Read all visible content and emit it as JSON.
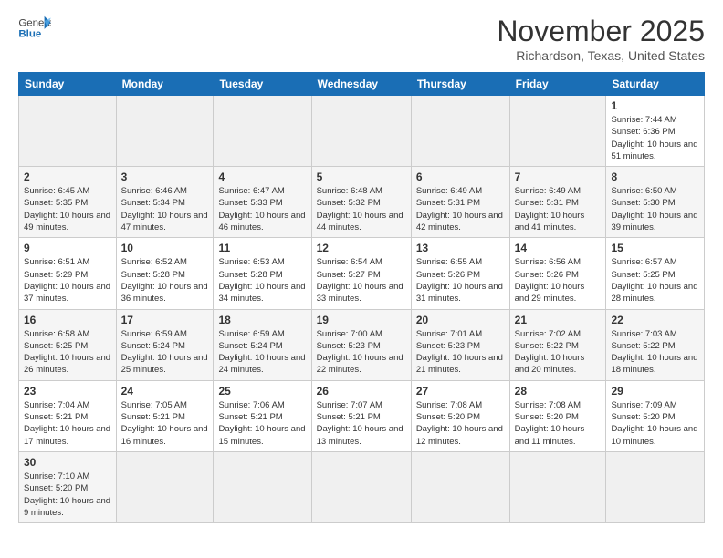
{
  "header": {
    "logo_general": "General",
    "logo_blue": "Blue",
    "month_title": "November 2025",
    "location": "Richardson, Texas, United States"
  },
  "weekdays": [
    "Sunday",
    "Monday",
    "Tuesday",
    "Wednesday",
    "Thursday",
    "Friday",
    "Saturday"
  ],
  "weeks": [
    [
      {
        "day": "",
        "info": ""
      },
      {
        "day": "",
        "info": ""
      },
      {
        "day": "",
        "info": ""
      },
      {
        "day": "",
        "info": ""
      },
      {
        "day": "",
        "info": ""
      },
      {
        "day": "",
        "info": ""
      },
      {
        "day": "1",
        "info": "Sunrise: 7:44 AM\nSunset: 6:36 PM\nDaylight: 10 hours and 51 minutes."
      }
    ],
    [
      {
        "day": "2",
        "info": "Sunrise: 6:45 AM\nSunset: 5:35 PM\nDaylight: 10 hours and 49 minutes."
      },
      {
        "day": "3",
        "info": "Sunrise: 6:46 AM\nSunset: 5:34 PM\nDaylight: 10 hours and 47 minutes."
      },
      {
        "day": "4",
        "info": "Sunrise: 6:47 AM\nSunset: 5:33 PM\nDaylight: 10 hours and 46 minutes."
      },
      {
        "day": "5",
        "info": "Sunrise: 6:48 AM\nSunset: 5:32 PM\nDaylight: 10 hours and 44 minutes."
      },
      {
        "day": "6",
        "info": "Sunrise: 6:49 AM\nSunset: 5:31 PM\nDaylight: 10 hours and 42 minutes."
      },
      {
        "day": "7",
        "info": "Sunrise: 6:49 AM\nSunset: 5:31 PM\nDaylight: 10 hours and 41 minutes."
      },
      {
        "day": "8",
        "info": "Sunrise: 6:50 AM\nSunset: 5:30 PM\nDaylight: 10 hours and 39 minutes."
      }
    ],
    [
      {
        "day": "9",
        "info": "Sunrise: 6:51 AM\nSunset: 5:29 PM\nDaylight: 10 hours and 37 minutes."
      },
      {
        "day": "10",
        "info": "Sunrise: 6:52 AM\nSunset: 5:28 PM\nDaylight: 10 hours and 36 minutes."
      },
      {
        "day": "11",
        "info": "Sunrise: 6:53 AM\nSunset: 5:28 PM\nDaylight: 10 hours and 34 minutes."
      },
      {
        "day": "12",
        "info": "Sunrise: 6:54 AM\nSunset: 5:27 PM\nDaylight: 10 hours and 33 minutes."
      },
      {
        "day": "13",
        "info": "Sunrise: 6:55 AM\nSunset: 5:26 PM\nDaylight: 10 hours and 31 minutes."
      },
      {
        "day": "14",
        "info": "Sunrise: 6:56 AM\nSunset: 5:26 PM\nDaylight: 10 hours and 29 minutes."
      },
      {
        "day": "15",
        "info": "Sunrise: 6:57 AM\nSunset: 5:25 PM\nDaylight: 10 hours and 28 minutes."
      }
    ],
    [
      {
        "day": "16",
        "info": "Sunrise: 6:58 AM\nSunset: 5:25 PM\nDaylight: 10 hours and 26 minutes."
      },
      {
        "day": "17",
        "info": "Sunrise: 6:59 AM\nSunset: 5:24 PM\nDaylight: 10 hours and 25 minutes."
      },
      {
        "day": "18",
        "info": "Sunrise: 6:59 AM\nSunset: 5:24 PM\nDaylight: 10 hours and 24 minutes."
      },
      {
        "day": "19",
        "info": "Sunrise: 7:00 AM\nSunset: 5:23 PM\nDaylight: 10 hours and 22 minutes."
      },
      {
        "day": "20",
        "info": "Sunrise: 7:01 AM\nSunset: 5:23 PM\nDaylight: 10 hours and 21 minutes."
      },
      {
        "day": "21",
        "info": "Sunrise: 7:02 AM\nSunset: 5:22 PM\nDaylight: 10 hours and 20 minutes."
      },
      {
        "day": "22",
        "info": "Sunrise: 7:03 AM\nSunset: 5:22 PM\nDaylight: 10 hours and 18 minutes."
      }
    ],
    [
      {
        "day": "23",
        "info": "Sunrise: 7:04 AM\nSunset: 5:21 PM\nDaylight: 10 hours and 17 minutes."
      },
      {
        "day": "24",
        "info": "Sunrise: 7:05 AM\nSunset: 5:21 PM\nDaylight: 10 hours and 16 minutes."
      },
      {
        "day": "25",
        "info": "Sunrise: 7:06 AM\nSunset: 5:21 PM\nDaylight: 10 hours and 15 minutes."
      },
      {
        "day": "26",
        "info": "Sunrise: 7:07 AM\nSunset: 5:21 PM\nDaylight: 10 hours and 13 minutes."
      },
      {
        "day": "27",
        "info": "Sunrise: 7:08 AM\nSunset: 5:20 PM\nDaylight: 10 hours and 12 minutes."
      },
      {
        "day": "28",
        "info": "Sunrise: 7:08 AM\nSunset: 5:20 PM\nDaylight: 10 hours and 11 minutes."
      },
      {
        "day": "29",
        "info": "Sunrise: 7:09 AM\nSunset: 5:20 PM\nDaylight: 10 hours and 10 minutes."
      }
    ],
    [
      {
        "day": "30",
        "info": "Sunrise: 7:10 AM\nSunset: 5:20 PM\nDaylight: 10 hours and 9 minutes."
      },
      {
        "day": "",
        "info": ""
      },
      {
        "day": "",
        "info": ""
      },
      {
        "day": "",
        "info": ""
      },
      {
        "day": "",
        "info": ""
      },
      {
        "day": "",
        "info": ""
      },
      {
        "day": "",
        "info": ""
      }
    ]
  ]
}
